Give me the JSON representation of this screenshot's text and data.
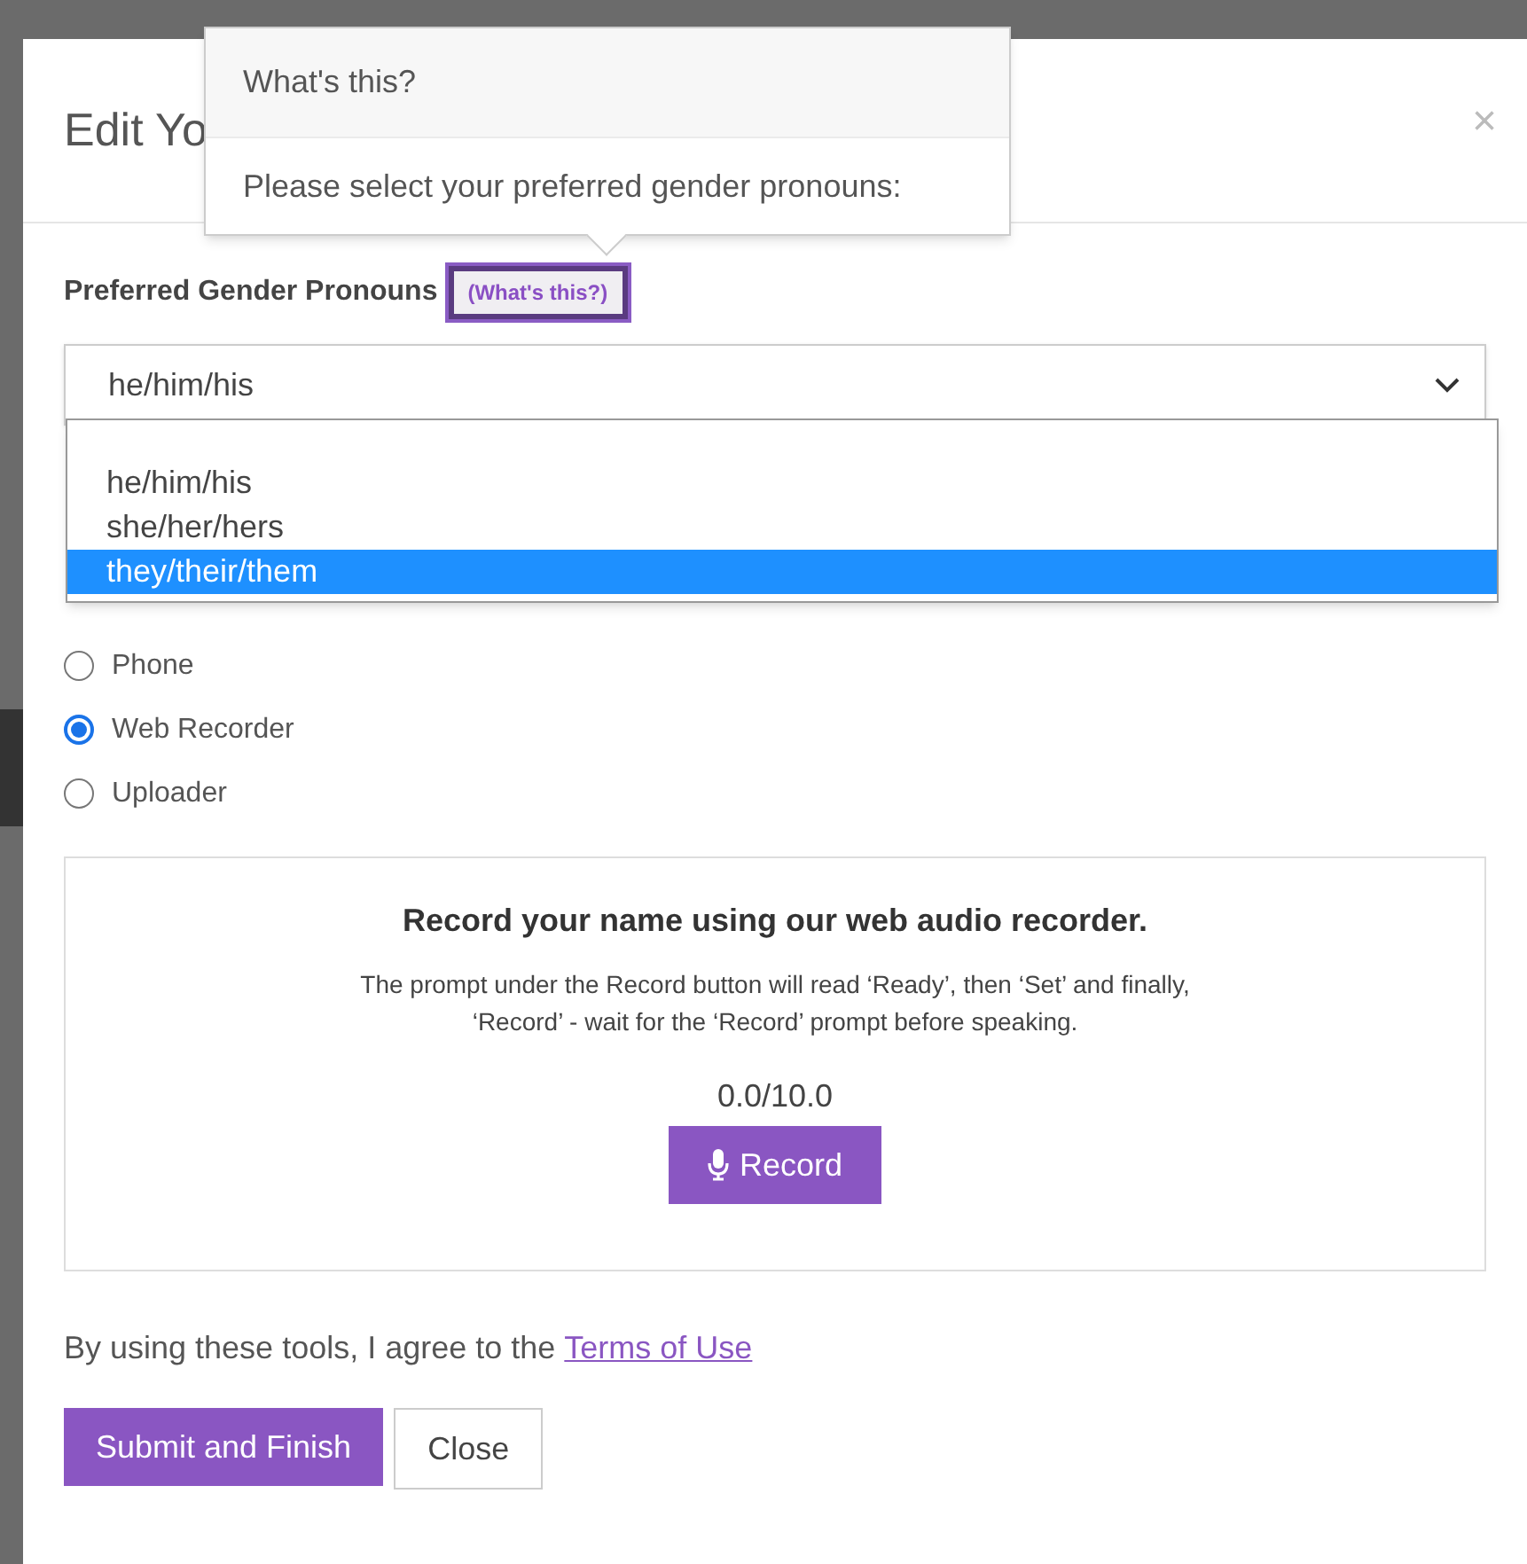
{
  "modal": {
    "title": "Edit Yo",
    "close": "×"
  },
  "popover": {
    "title": "What's this?",
    "body": "Please select your preferred gender pronouns:"
  },
  "pronouns": {
    "label": "Preferred Gender Pronouns",
    "help_link": "(What's this?)",
    "value": "he/him/his",
    "options": [
      {
        "label": "he/him/his",
        "highlighted": false
      },
      {
        "label": "she/her/hers",
        "highlighted": false
      },
      {
        "label": "they/their/them",
        "highlighted": true
      }
    ]
  },
  "methods": [
    {
      "label": "Phone",
      "selected": false
    },
    {
      "label": "Web Recorder",
      "selected": true
    },
    {
      "label": "Uploader",
      "selected": false
    }
  ],
  "recorder": {
    "heading": "Record your name using our web audio recorder.",
    "instructions": "The prompt under the Record button will read ‘Ready’, then ‘Set’ and finally, ‘Record’ - wait for the ‘Record’ prompt before speaking.",
    "time": "0.0/10.0",
    "button": "Record"
  },
  "terms": {
    "text": "By using these tools, I agree to the",
    "link": "Terms of Use"
  },
  "buttons": [
    {
      "label": "Submit and Finish",
      "kind": "primary"
    },
    {
      "label": "Close",
      "kind": "default"
    }
  ]
}
